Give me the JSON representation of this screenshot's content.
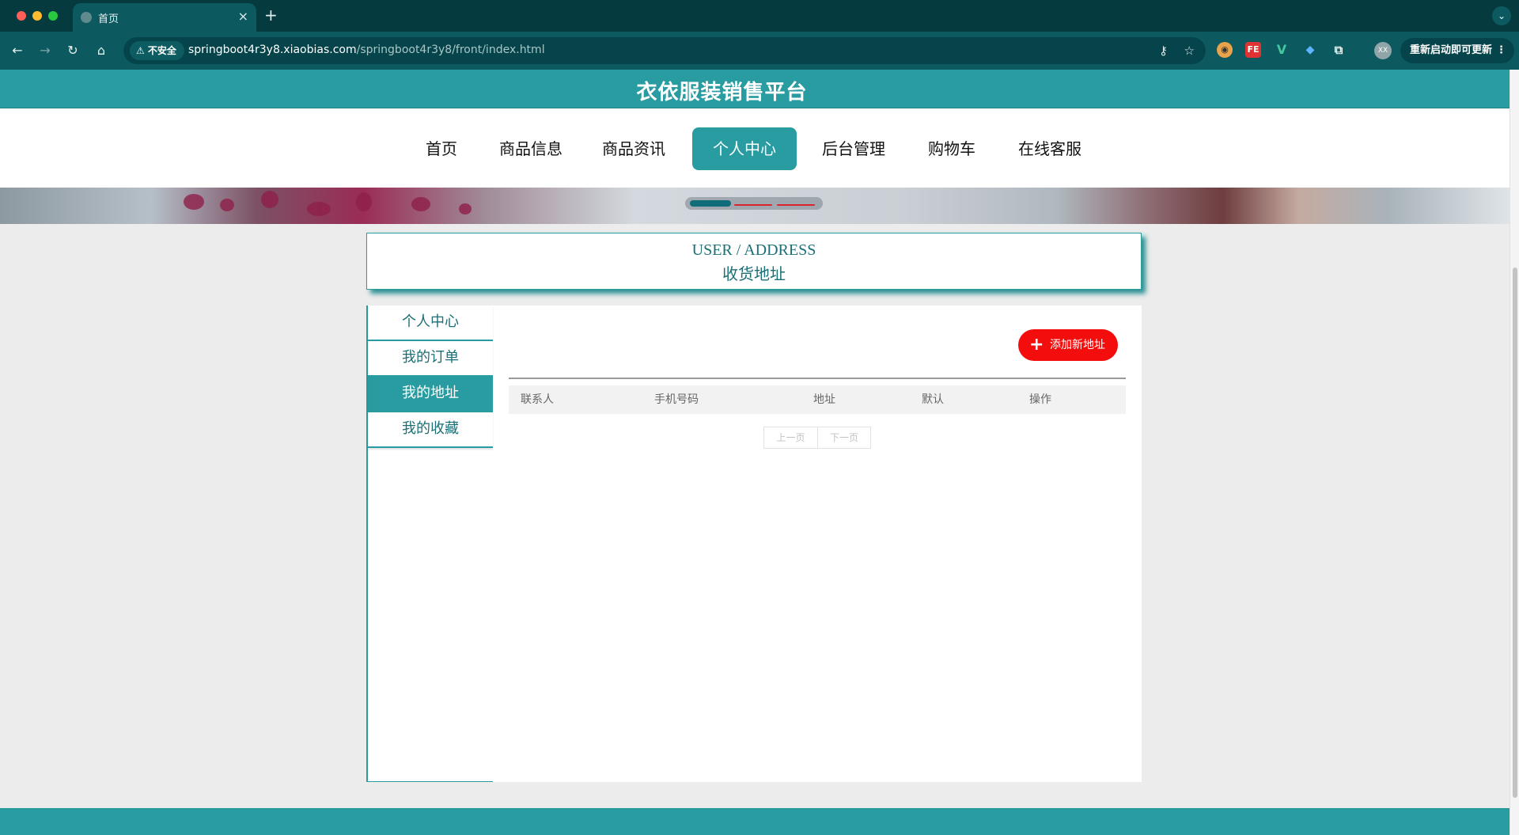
{
  "browser": {
    "tab_title": "首页",
    "close_glyph": "×",
    "new_tab_glyph": "+",
    "security_label": "⚠ 不安全",
    "url_host": "springboot4r3y8.xiaobias.com",
    "url_path": "/springboot4r3y8/front/index.html",
    "update_label": "重新启动即可更新",
    "profile_initials": "XX",
    "extensions": [
      "owl-extension-icon",
      "fe-extension-icon",
      "vue-devtools-icon",
      "diamond-extension-icon",
      "puzzle-extensions-icon"
    ]
  },
  "site": {
    "title": "衣依服装销售平台"
  },
  "nav": {
    "items": [
      {
        "label": "首页"
      },
      {
        "label": "商品信息"
      },
      {
        "label": "商品资讯"
      },
      {
        "label": "个人中心"
      },
      {
        "label": "后台管理"
      },
      {
        "label": "购物车"
      },
      {
        "label": "在线客服"
      }
    ],
    "active_index": 3
  },
  "page_heading": {
    "en": "USER / ADDRESS",
    "cn": "收货地址"
  },
  "side_menu": {
    "items": [
      {
        "label": "个人中心"
      },
      {
        "label": "我的订单"
      },
      {
        "label": "我的地址"
      },
      {
        "label": "我的收藏"
      }
    ],
    "active_index": 2
  },
  "address": {
    "add_button_label": "添加新地址",
    "columns": [
      "联系人",
      "手机号码",
      "地址",
      "默认",
      "操作"
    ],
    "rows": []
  },
  "pager": {
    "prev_label": "上一页",
    "next_label": "下一页"
  },
  "colors": {
    "brand": "#289ca0",
    "accent_red": "#f30d0d",
    "chrome_dark": "#053a3f"
  }
}
